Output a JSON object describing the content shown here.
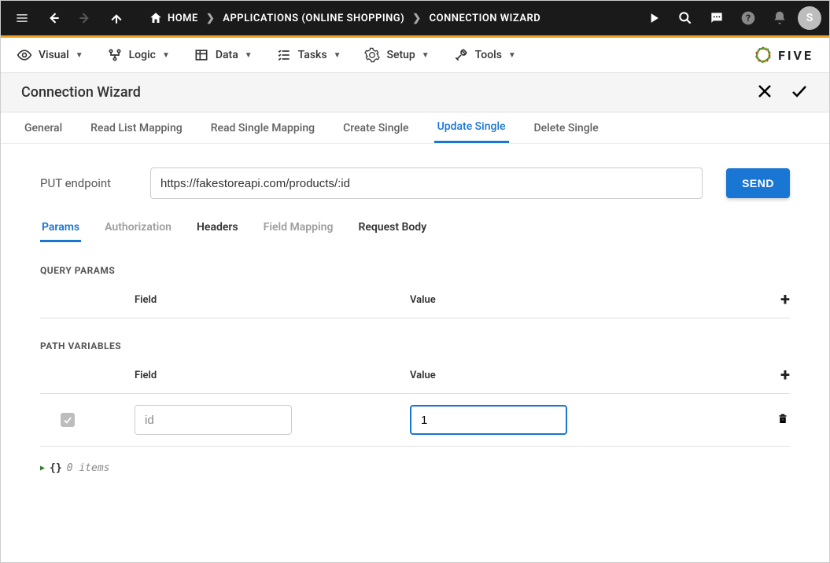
{
  "topbar": {
    "breadcrumbs": [
      {
        "label": "HOME",
        "has_icon": true
      },
      {
        "label": "APPLICATIONS (ONLINE SHOPPING)"
      },
      {
        "label": "CONNECTION WIZARD"
      }
    ],
    "avatar_initial": "S"
  },
  "menubar": {
    "items": [
      {
        "label": "Visual",
        "icon": "eye"
      },
      {
        "label": "Logic",
        "icon": "branch"
      },
      {
        "label": "Data",
        "icon": "table"
      },
      {
        "label": "Tasks",
        "icon": "list"
      },
      {
        "label": "Setup",
        "icon": "gear"
      },
      {
        "label": "Tools",
        "icon": "wrench"
      }
    ],
    "logo_text": "FIVE"
  },
  "page": {
    "title": "Connection Wizard"
  },
  "wizard_tabs": [
    {
      "label": "General",
      "active": false
    },
    {
      "label": "Read List Mapping",
      "active": false
    },
    {
      "label": "Read Single Mapping",
      "active": false
    },
    {
      "label": "Create Single",
      "active": false
    },
    {
      "label": "Update Single",
      "active": true
    },
    {
      "label": "Delete Single",
      "active": false
    }
  ],
  "endpoint": {
    "label": "PUT endpoint",
    "value": "https://fakestoreapi.com/products/:id",
    "send_label": "SEND"
  },
  "subtabs": [
    {
      "label": "Params",
      "active": true
    },
    {
      "label": "Authorization",
      "dim": true
    },
    {
      "label": "Headers"
    },
    {
      "label": "Field Mapping",
      "dim": true
    },
    {
      "label": "Request Body"
    }
  ],
  "sections": {
    "query_params": {
      "title": "QUERY PARAMS",
      "headers": {
        "field": "Field",
        "value": "Value"
      },
      "rows": []
    },
    "path_variables": {
      "title": "PATH VARIABLES",
      "headers": {
        "field": "Field",
        "value": "Value"
      },
      "rows": [
        {
          "field": "id",
          "value": "1",
          "checked": true,
          "readonly_field": true
        }
      ]
    }
  },
  "json_preview": {
    "items_label": "0 items"
  }
}
